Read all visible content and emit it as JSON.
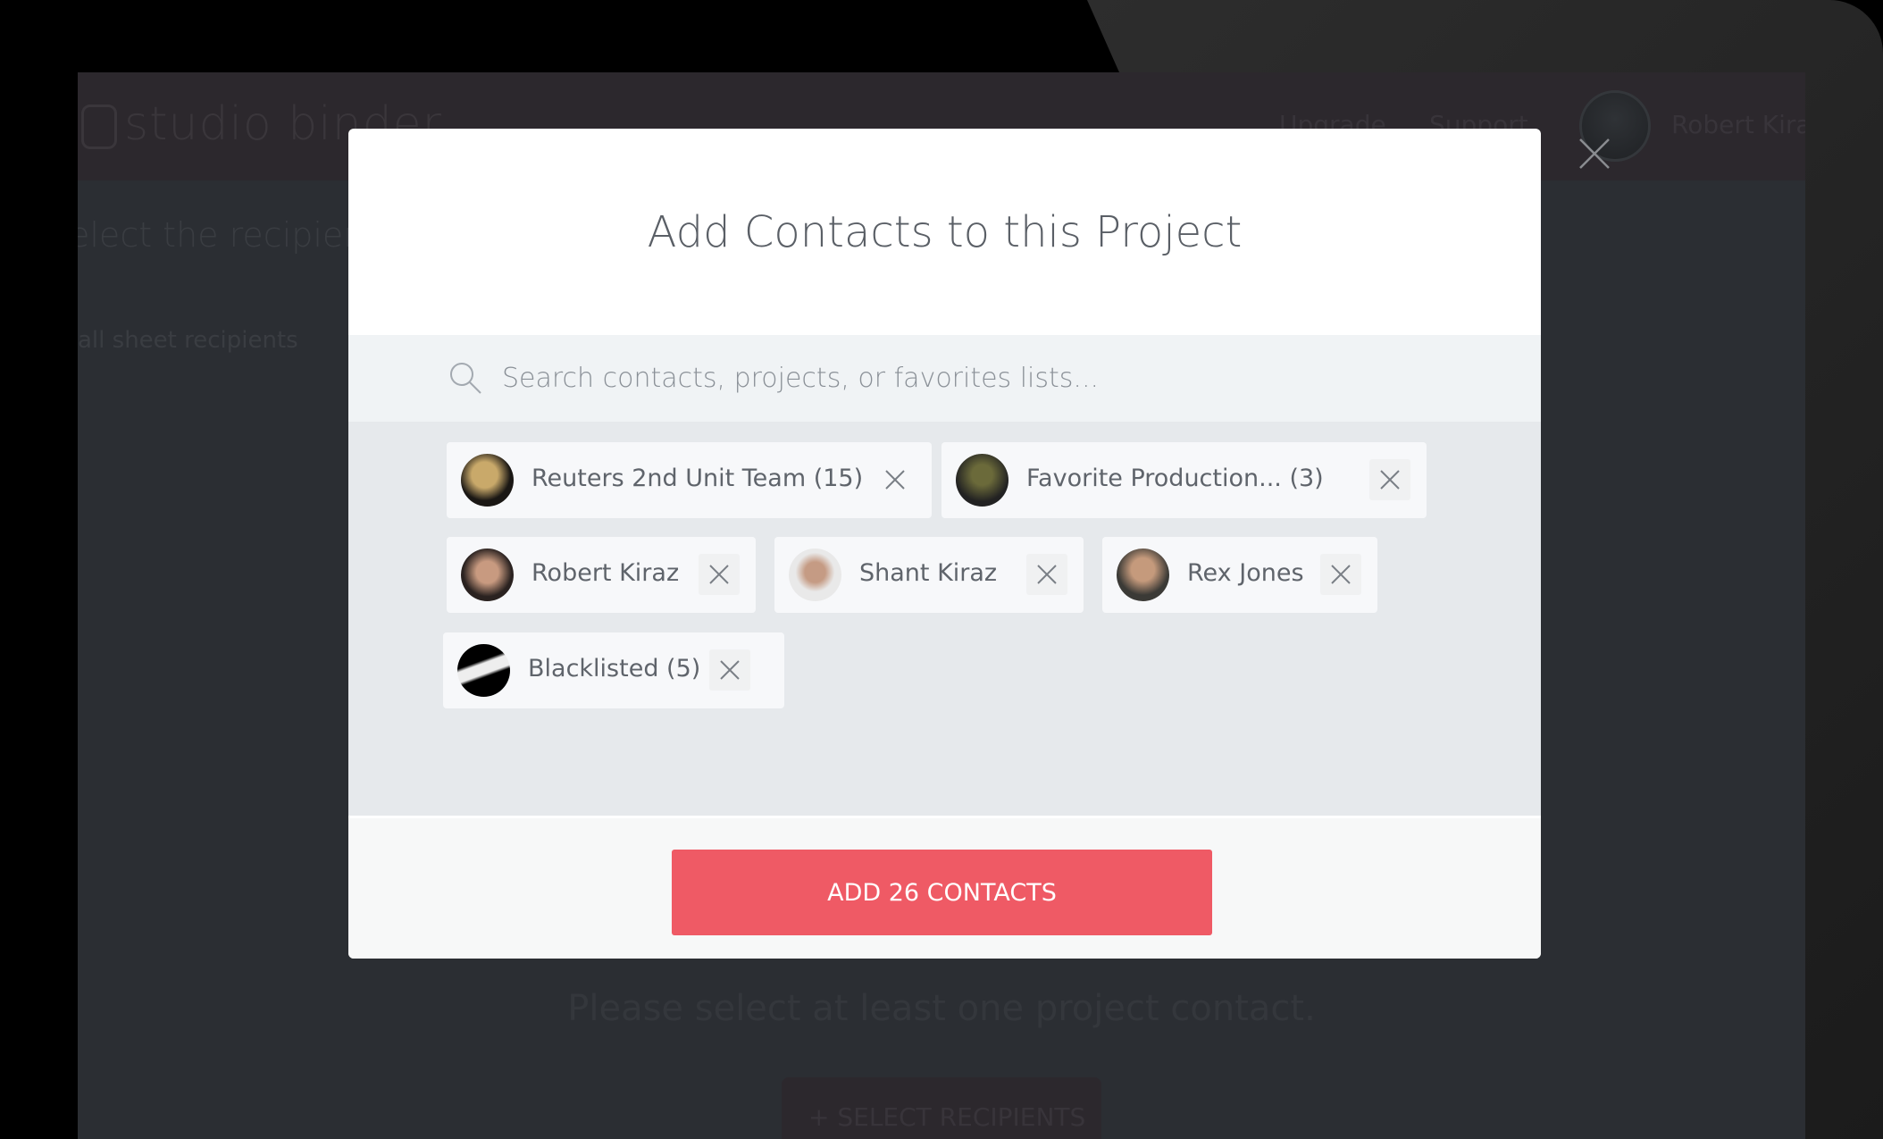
{
  "background": {
    "logo": "studio binder",
    "nav": [
      "Upgrade",
      "Support"
    ],
    "user_name": "Robert Kiraz",
    "heading": "elect the recipients",
    "subheading": "all sheet recipients",
    "message": "Please select at least one project contact.",
    "select_button": "+ SELECT RECIPIENTS"
  },
  "modal": {
    "title": "Add Contacts to this Project",
    "search": {
      "placeholder": "Search contacts, projects, or favorites lists...",
      "value": ""
    },
    "chips": [
      {
        "label": "Reuters 2nd Unit Team (15)",
        "type": "group"
      },
      {
        "label": "Favorite Production... (3)",
        "type": "group"
      },
      {
        "label": "Robert Kiraz",
        "type": "person"
      },
      {
        "label": "Shant Kiraz",
        "type": "person"
      },
      {
        "label": "Rex Jones",
        "type": "person"
      },
      {
        "label": "Blacklisted (5)",
        "type": "group"
      }
    ],
    "submit_label": "ADD 26 CONTACTS"
  },
  "colors": {
    "accent": "#ef5a65",
    "header": "#2c282d",
    "overlay": "#2b2e33"
  }
}
